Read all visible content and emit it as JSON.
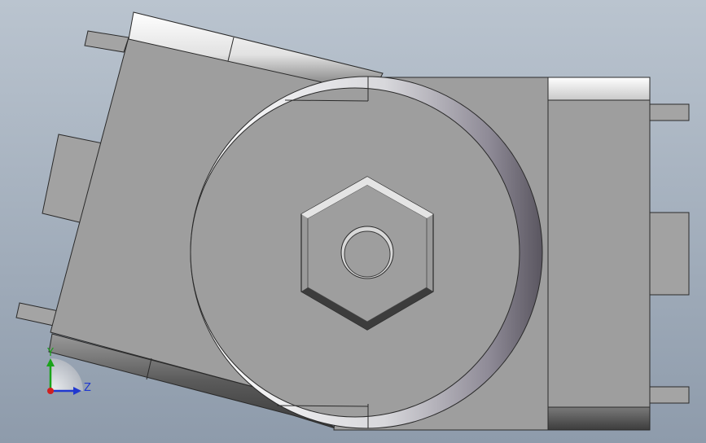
{
  "viewport": {
    "background_top": "#bac4cf",
    "background_bottom": "#8e9bab"
  },
  "model": {
    "face_color": "#9e9e9e",
    "edge_color": "#2a2a2a",
    "highlight_color": "#f4f4f4",
    "shadow_color": "#505050"
  },
  "triad": {
    "y_label": "Y",
    "z_label": "Z",
    "y_color": "#1aa31a",
    "z_color": "#2038d0",
    "origin_color": "#d02020"
  }
}
